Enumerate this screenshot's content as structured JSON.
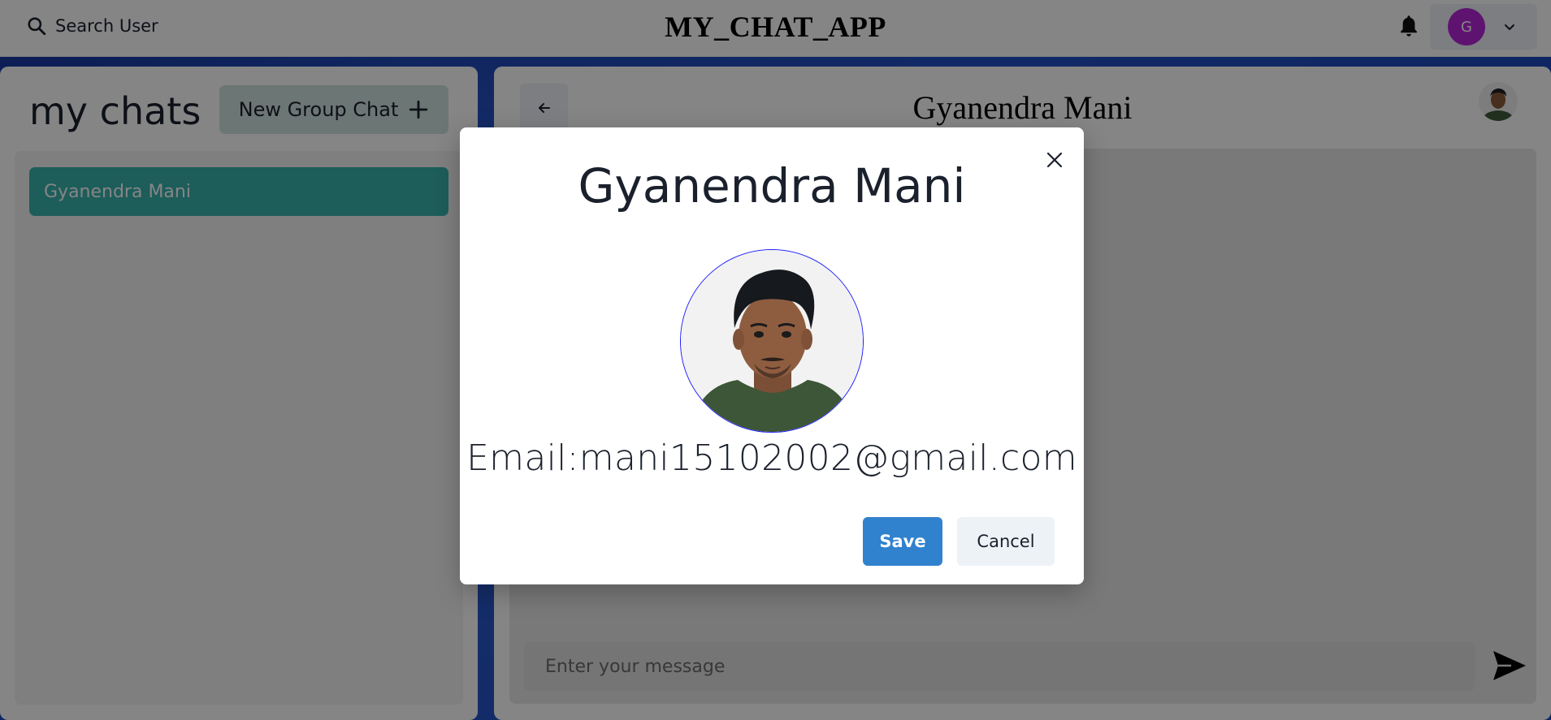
{
  "header": {
    "search_label": "Search User",
    "app_title": "MY_CHAT_APP",
    "user_initial": "G",
    "icons": {
      "search": "search-icon",
      "notifications": "bell-icon",
      "menu": "chevron-down-icon"
    }
  },
  "sidebar": {
    "title": "my chats",
    "new_group_label": "New Group Chat",
    "chats": [
      {
        "name": "Gyanendra Mani",
        "selected": true
      }
    ]
  },
  "chat": {
    "header_name": "Gyanendra Mani",
    "message_placeholder": "Enter your message"
  },
  "profile_modal": {
    "name": "Gyanendra Mani",
    "email_text": "Email:mani15102002@gmail.com",
    "save_label": "Save",
    "cancel_label": "Cancel"
  },
  "colors": {
    "accent_teal": "#38B2AC",
    "button_blue": "#3182CE",
    "avatar_purple": "#B626D8",
    "background_blue": "#1E3FA8"
  }
}
